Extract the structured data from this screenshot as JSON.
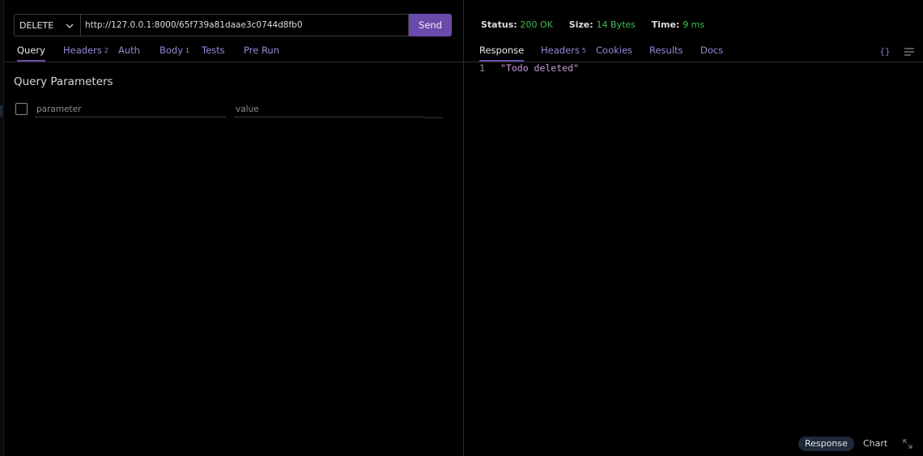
{
  "request": {
    "method": "DELETE",
    "url": "http://127.0.0.1:8000/65f739a81daae3c0744d8fb0",
    "send_label": "Send",
    "tabs": [
      {
        "label": "Query",
        "badge": ""
      },
      {
        "label": "Headers",
        "badge": "2"
      },
      {
        "label": "Auth",
        "badge": ""
      },
      {
        "label": "Body",
        "badge": "1"
      },
      {
        "label": "Tests",
        "badge": ""
      },
      {
        "label": "Pre Run",
        "badge": ""
      }
    ],
    "active_tab": "Query",
    "query": {
      "title": "Query Parameters",
      "parameter_placeholder": "parameter",
      "value_placeholder": "value"
    }
  },
  "response": {
    "status_label": "Status:",
    "status_value": "200 OK",
    "size_label": "Size:",
    "size_value": "14 Bytes",
    "time_label": "Time:",
    "time_value": "9 ms",
    "tabs": [
      {
        "label": "Response",
        "badge": ""
      },
      {
        "label": "Headers",
        "badge": "5"
      },
      {
        "label": "Cookies",
        "badge": ""
      },
      {
        "label": "Results",
        "badge": ""
      },
      {
        "label": "Docs",
        "badge": ""
      }
    ],
    "active_tab": "Response",
    "body_line_number": "1",
    "body_text": "\"Todo deleted\"",
    "format_icon_glyph": "{}",
    "bottom": {
      "response_label": "Response",
      "chart_label": "Chart"
    }
  },
  "colors": {
    "accent": "#6a4bab",
    "tab_text": "#9a86d6",
    "status_ok": "#3fbf55",
    "string": "#c79bd8"
  },
  "icons": [
    "chevron-down-icon",
    "checkbox-icon",
    "format-json-icon",
    "menu-lines-icon",
    "expand-icon"
  ]
}
